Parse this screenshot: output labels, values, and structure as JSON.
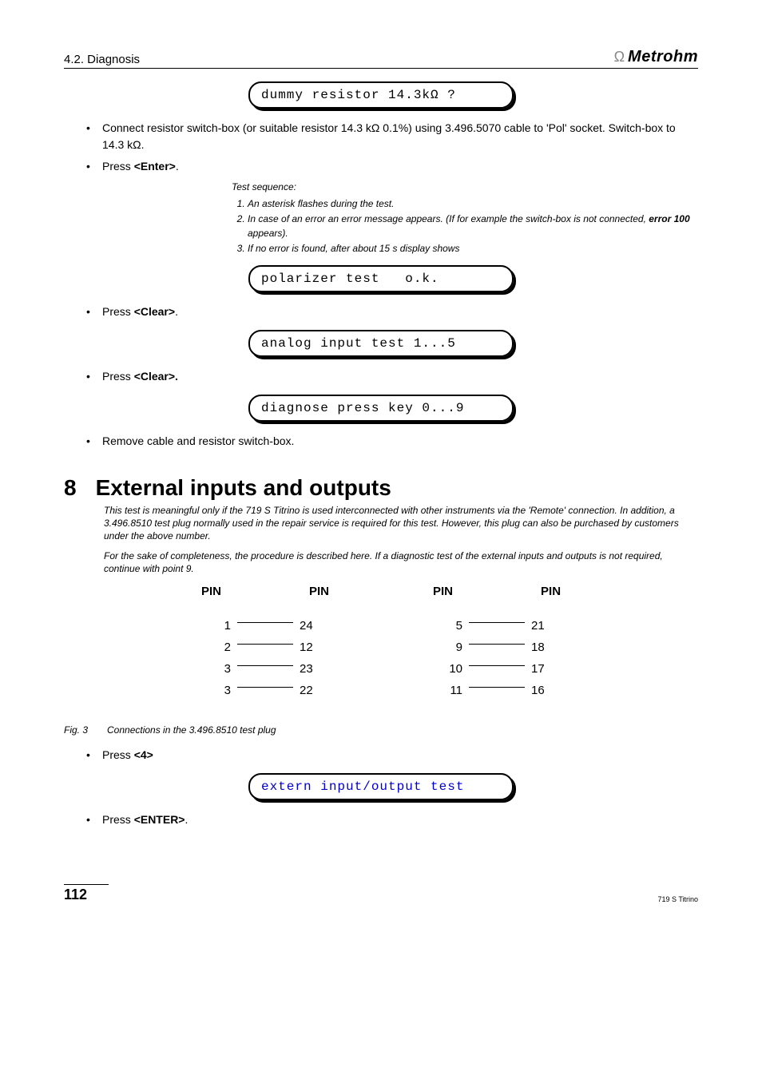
{
  "header": {
    "section": "4.2. Diagnosis",
    "brand": "Metrohm"
  },
  "displays": {
    "d1": "dummy resistor 14.3kΩ ?",
    "d2": "polarizer test   o.k.",
    "d3": "analog input test 1...5",
    "d4": "diagnose press key 0...9",
    "d5": "extern input/output test"
  },
  "steps": {
    "connect": "Connect resistor switch-box (or suitable resistor 14.3 kΩ 0.1%) using 3.496.5070 cable to 'Pol' socket. Switch-box to 14.3 kΩ.",
    "pressEnter": "Press ",
    "enterKey": "<Enter>",
    "pressClear1": "Press ",
    "clearKey1": "<Clear>",
    "pressClear2": "Press ",
    "clearKey2": "<Clear>.",
    "remove": "Remove cable and resistor switch-box.",
    "press4": "Press ",
    "key4": "<4>",
    "pressEnter2": "Press ",
    "enterKey2": "<ENTER>"
  },
  "testSeq": {
    "label": "Test sequence:",
    "i1": "An asterisk flashes during the test.",
    "i2a": "In case of an error an error message appears. (If for example the switch-box is not connected, ",
    "i2err": "error 100",
    "i2b": " appears).",
    "i3": "If no error is found, after about 15 s display shows"
  },
  "section8": {
    "num": "8",
    "title": "External inputs and outputs",
    "note1": "This test is meaningful only if the 719 S Titrino is used interconnected with other instruments via the 'Remote' connection. In addition, a 3.496.8510 test plug normally used in the repair service is required for this test. However, this plug can also be purchased by customers under the above number.",
    "note2": "For the sake of completeness, the procedure is described here. If a diagnostic test of the external inputs and outputs is not required, continue with point 9."
  },
  "pins": {
    "hdr": "PIN",
    "left": [
      {
        "a": "1",
        "b": "24"
      },
      {
        "a": "2",
        "b": "12"
      },
      {
        "a": "3",
        "b": "23"
      },
      {
        "a": "3",
        "b": "22"
      }
    ],
    "right": [
      {
        "a": "5",
        "b": "21"
      },
      {
        "a": "9",
        "b": "18"
      },
      {
        "a": "10",
        "b": "17"
      },
      {
        "a": "11",
        "b": "16"
      }
    ]
  },
  "fig": {
    "num": "Fig. 3",
    "caption": "Connections in the 3.496.8510 test plug"
  },
  "footer": {
    "page": "112",
    "model": "719 S Titrino"
  }
}
